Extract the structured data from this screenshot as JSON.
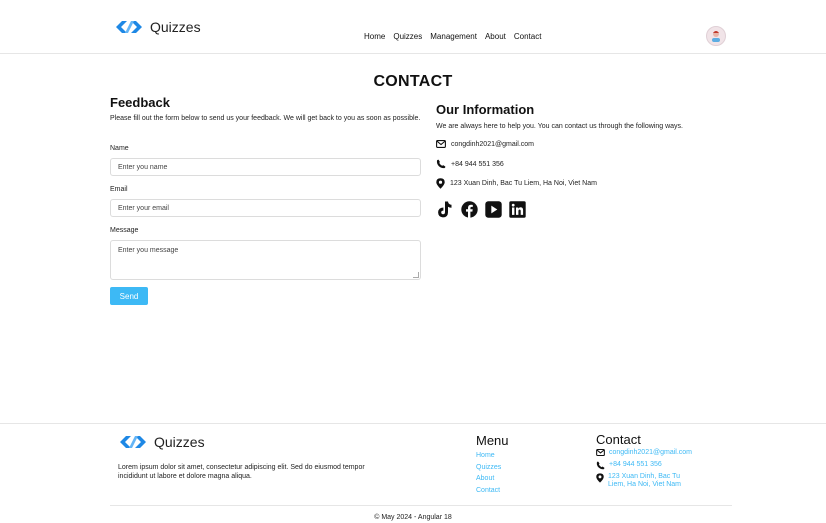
{
  "header": {
    "brand": "Quizzes",
    "nav": [
      "Home",
      "Quizzes",
      "Management",
      "About",
      "Contact"
    ]
  },
  "page_title": "CONTACT",
  "feedback": {
    "title": "Feedback",
    "description": "Please fill out the form below to send us your feedback. We will get back to you as soon as possible.",
    "name_label": "Name",
    "name_placeholder": "Enter you name",
    "email_label": "Email",
    "email_placeholder": "Enter your email",
    "message_label": "Message",
    "message_placeholder": "Enter you message",
    "send_label": "Send"
  },
  "info": {
    "title": "Our Information",
    "description": "We are always here to help you. You can contact us through the following ways.",
    "email": "congdinh2021@gmail.com",
    "phone": "+84 944 551 356",
    "address": "123 Xuan Dinh, Bac Tu Liem, Ha Noi, Viet Nam",
    "socials": [
      "tiktok-icon",
      "facebook-icon",
      "youtube-icon",
      "linkedin-icon"
    ]
  },
  "footer": {
    "brand": "Quizzes",
    "about": "Lorem ipsum dolor sit amet, consectetur adipiscing elit. Sed do eiusmod tempor incididunt ut labore et dolore magna aliqua.",
    "menu_title": "Menu",
    "menu": [
      "Home",
      "Quizzes",
      "About",
      "Contact"
    ],
    "contact_title": "Contact",
    "email": "congdinh2021@gmail.com",
    "phone": "+84 944 551 356",
    "address": "123 Xuan Dinh, Bac Tu Liem, Ha Noi, Viet Nam",
    "copyright": "© May 2024 - Angular 18"
  },
  "colors": {
    "accent": "#3db9f5",
    "logo_blue": "#1e88e5"
  }
}
